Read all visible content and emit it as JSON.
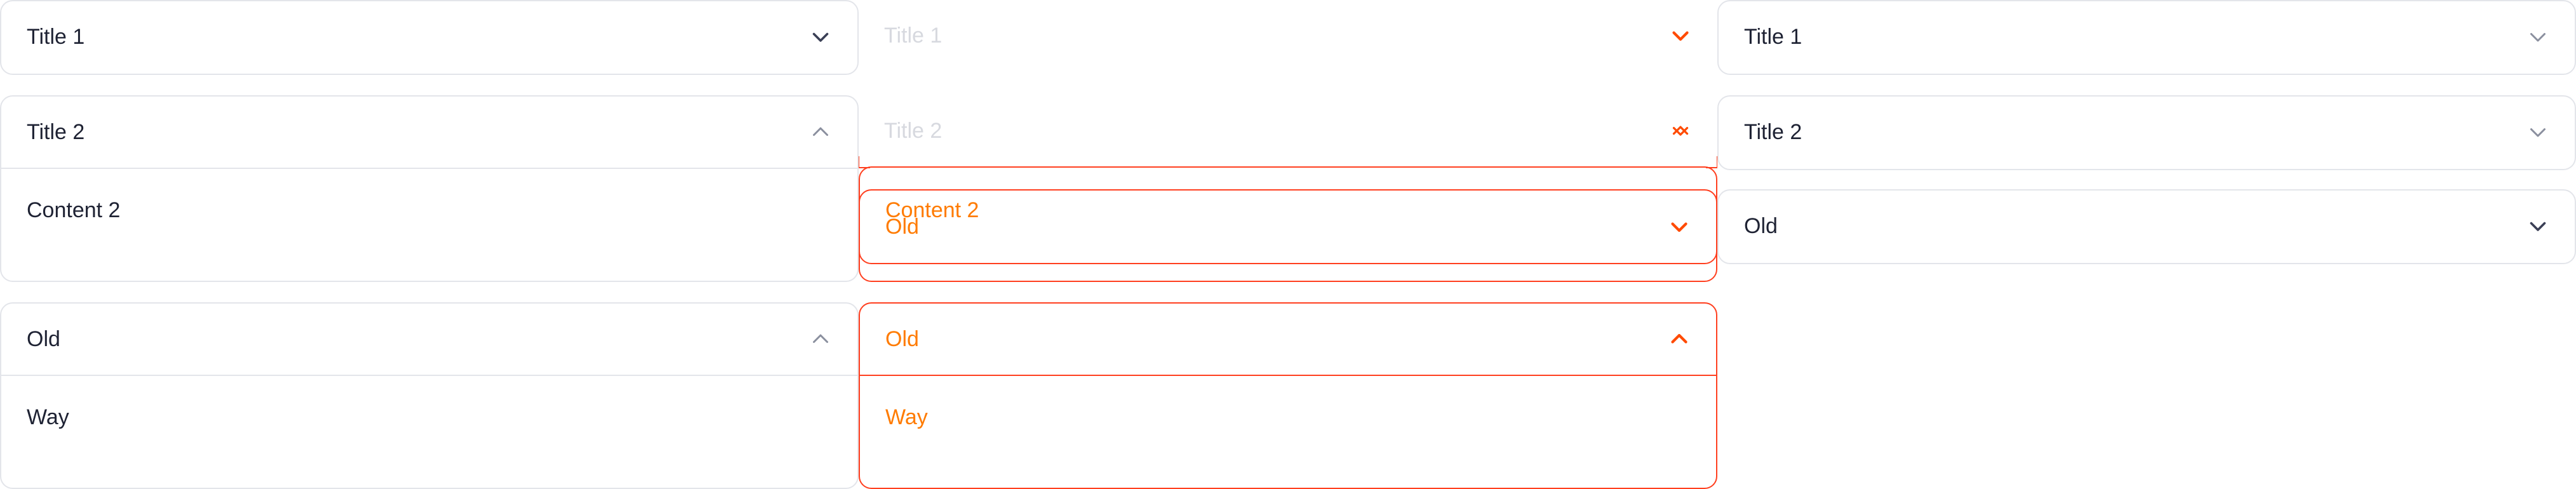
{
  "column_default": {
    "item1": {
      "title": "Title 1",
      "state": "collapsed"
    },
    "item2": {
      "title": "Title 2",
      "state": "expanded",
      "content": "Content 2"
    },
    "item3": {
      "title": "Old",
      "state": "expanded",
      "content": "Way"
    }
  },
  "column_highlight": {
    "item1": {
      "title": "Title 1",
      "state": "collapsed"
    },
    "item2": {
      "title": "Title 2",
      "state": "expanded",
      "content": "Content 2"
    },
    "overlay": {
      "title": "Old",
      "state": "collapsed"
    },
    "item3": {
      "title": "Old",
      "state": "expanded",
      "content": "Way"
    }
  },
  "column_right": {
    "item1": {
      "title": "Title 1",
      "state": "collapsed"
    },
    "item2": {
      "title": "Title 2",
      "state": "collapsed"
    },
    "item3": {
      "title": "Old",
      "state": "collapsed"
    }
  },
  "colors": {
    "border": "#e3e5ea",
    "text": "#1e2233",
    "highlight_border": "#ff3f1f",
    "highlight_text": "#ff7b00",
    "faded_text": "#d7d9df",
    "chevron": "#6b7080"
  },
  "icons": {
    "collapsed": "chevron-down-icon",
    "expanded": "chevron-up-icon"
  }
}
